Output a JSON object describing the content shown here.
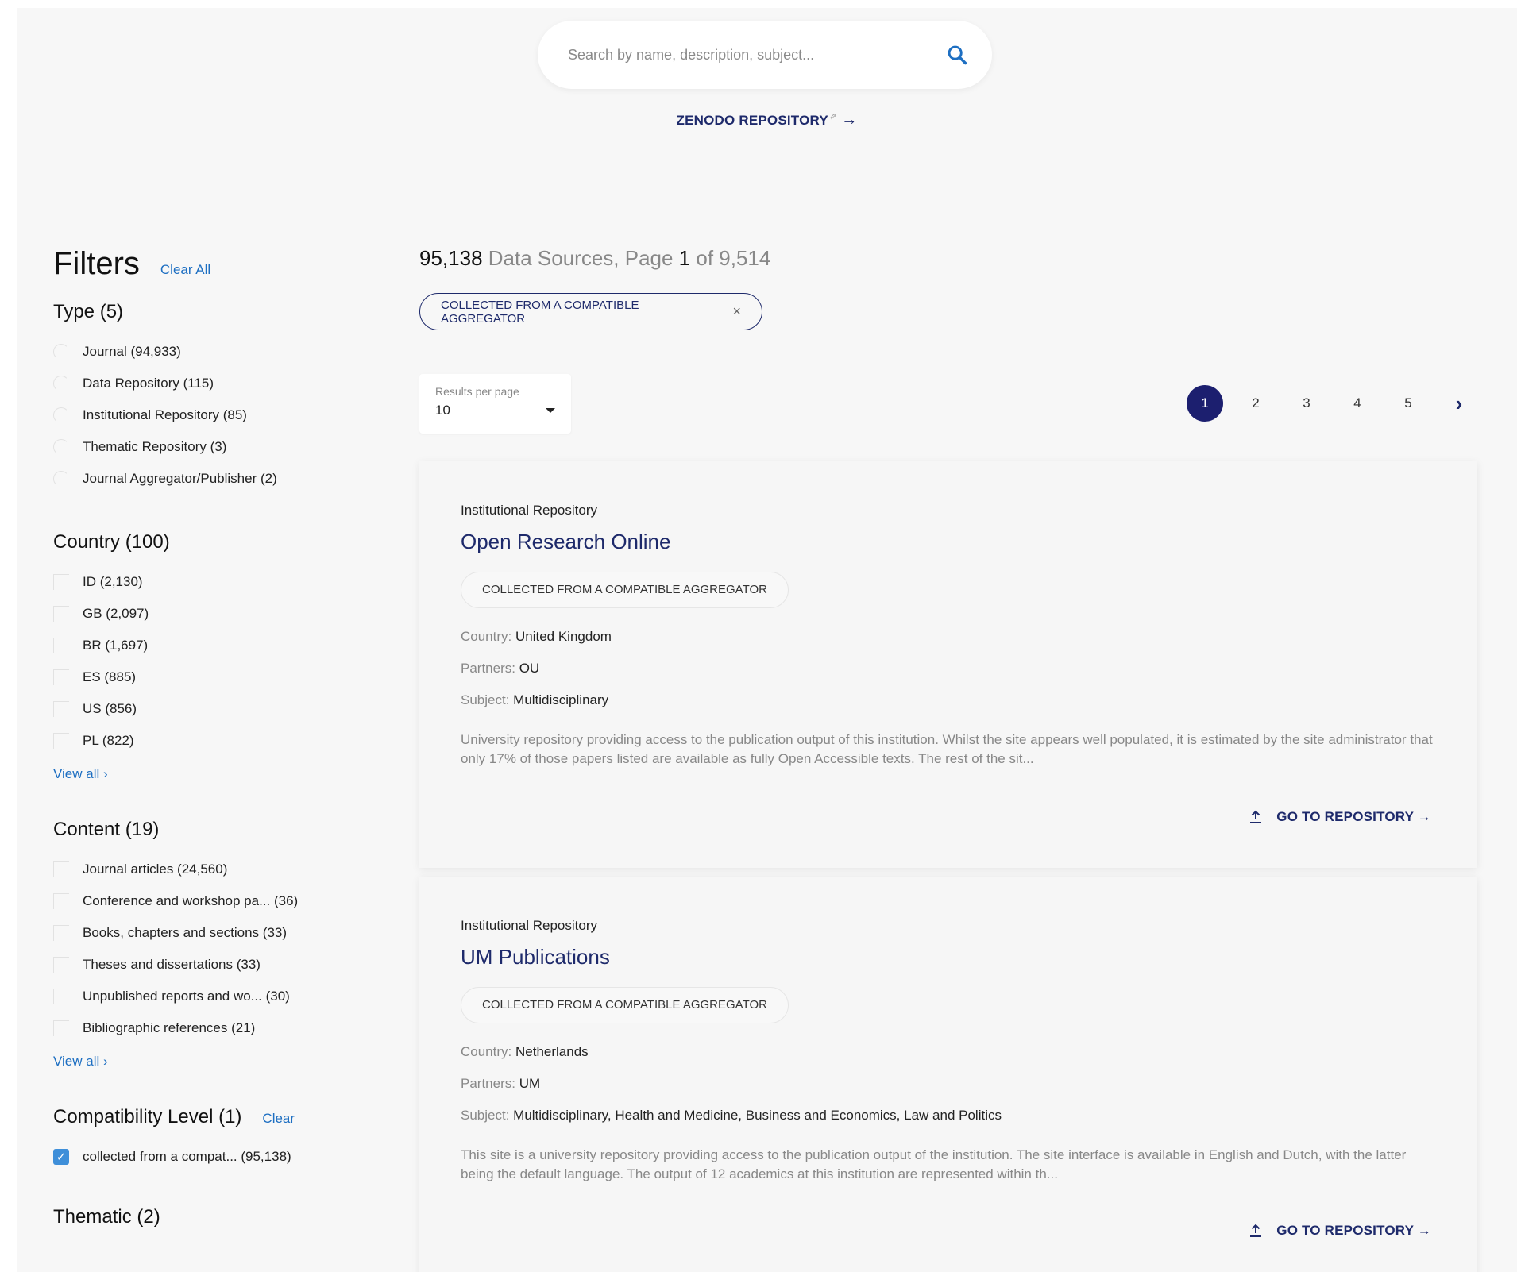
{
  "search": {
    "placeholder": "Search by name, description, subject..."
  },
  "zenodo": {
    "label": "ZENODO REPOSITORY",
    "arrow": "→"
  },
  "filters": {
    "title": "Filters",
    "clear_all": "Clear All",
    "type": {
      "title": "Type (5)",
      "options": [
        "Journal (94,933)",
        "Data Repository (115)",
        "Institutional Repository (85)",
        "Thematic Repository (3)",
        "Journal Aggregator/Publisher (2)"
      ]
    },
    "country": {
      "title": "Country (100)",
      "options": [
        "ID (2,130)",
        "GB (2,097)",
        "BR (1,697)",
        "ES (885)",
        "US (856)",
        "PL (822)"
      ],
      "view_all": "View all ›"
    },
    "content": {
      "title": "Content (19)",
      "options": [
        "Journal articles (24,560)",
        "Conference and workshop pa... (36)",
        "Books, chapters and sections (33)",
        "Theses and dissertations (33)",
        "Unpublished reports and wo... (30)",
        "Bibliographic references (21)"
      ],
      "view_all": "View all ›"
    },
    "compatibility": {
      "title": "Compatibility Level (1)",
      "clear": "Clear",
      "options": [
        "collected from a compat... (95,138)"
      ]
    },
    "thematic": {
      "title": "Thematic (2)"
    }
  },
  "results": {
    "total": "95,138",
    "label_mid": " Data Sources, Page ",
    "page": "1",
    "label_of": " of ",
    "pages": "9,514",
    "active_filter": "COLLECTED FROM A COMPATIBLE AGGREGATOR",
    "active_filter_remove": "×"
  },
  "rpp": {
    "label": "Results per page",
    "value": "10"
  },
  "pager": {
    "pages": [
      "1",
      "2",
      "3",
      "4",
      "5"
    ],
    "next": "›"
  },
  "cards": [
    {
      "type": "Institutional Repository",
      "title": "Open Research Online",
      "badge": "COLLECTED FROM A COMPATIBLE AGGREGATOR",
      "country_label": "Country: ",
      "country": "United Kingdom",
      "partners_label": "Partners: ",
      "partners": "OU",
      "subject_label": "Subject: ",
      "subject": "Multidisciplinary",
      "description": "University repository providing access to the publication output of this institution. Whilst the site appears well populated, it is estimated by the site administrator that only 17% of those papers listed are available as fully Open Accessible texts. The rest of the sit...",
      "goto": "GO TO REPOSITORY →"
    },
    {
      "type": "Institutional Repository",
      "title": "UM Publications",
      "badge": "COLLECTED FROM A COMPATIBLE AGGREGATOR",
      "country_label": "Country: ",
      "country": "Netherlands",
      "partners_label": "Partners: ",
      "partners": "UM",
      "subject_label": "Subject: ",
      "subject": "Multidisciplinary, Health and Medicine, Business and Economics, Law and Politics",
      "description": "This site is a university repository providing access to the publication output of the institution. The site interface is available in English and Dutch, with the latter being the default language. The output of 12 academics at this institution are represented within th...",
      "goto": "GO TO REPOSITORY →"
    }
  ],
  "colors": {
    "accent": "#1e2a6b",
    "link": "#1e6fc2",
    "active_page": "#1c1f6f",
    "checkbox": "#3f8fd9"
  }
}
